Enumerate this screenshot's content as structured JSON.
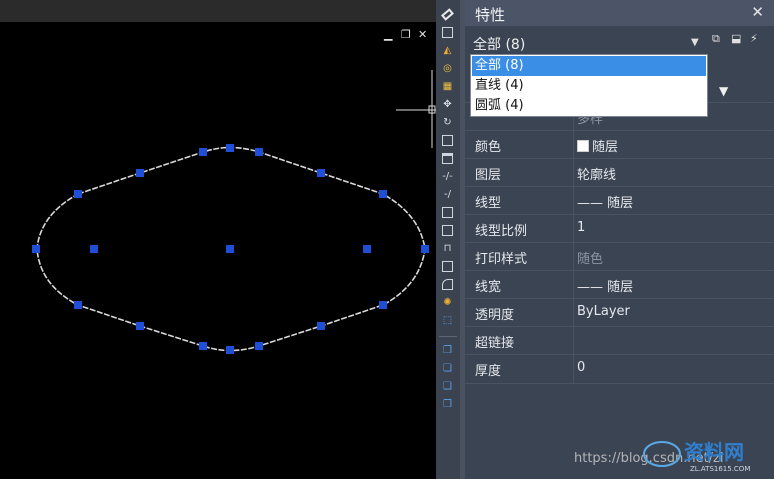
{
  "canvas": {
    "window_controls": {
      "minimize": "▁",
      "restore": "❐",
      "close": "✕"
    }
  },
  "toolbar": {
    "icons": [
      "eraser-icon",
      "copy-icon",
      "mirror-icon",
      "offset-icon",
      "array-icon",
      "move-icon",
      "rotate-icon",
      "scale-icon",
      "stretch-icon",
      "trim-icon",
      "extend-icon",
      "break-icon",
      "break-at-point-icon",
      "join-icon",
      "chamfer-icon",
      "fillet-icon",
      "blend-icon",
      "explode-icon",
      "edit-icon",
      "draw-order-icon",
      "bring-front-icon",
      "send-back-icon",
      "text-front-icon"
    ]
  },
  "panel": {
    "title": "特性",
    "close_label": "✕",
    "selector": {
      "value": "全部 (8)"
    },
    "dropdown": {
      "options": [
        "全部 (8)",
        "直线 (4)",
        "圆弧 (4)"
      ],
      "selected_index": 0
    },
    "properties": [
      {
        "name": "",
        "value": "多样",
        "muted": true,
        "partial": true
      },
      {
        "name": "颜色",
        "value": "随层",
        "swatch": "#ffffff"
      },
      {
        "name": "图层",
        "value": "轮廓线"
      },
      {
        "name": "线型",
        "value": "—— 随层"
      },
      {
        "name": "线型比例",
        "value": "1"
      },
      {
        "name": "打印样式",
        "value": "随色",
        "muted": true
      },
      {
        "name": "线宽",
        "value": "—— 随层"
      },
      {
        "name": "透明度",
        "value": "ByLayer"
      },
      {
        "name": "超链接",
        "value": ""
      },
      {
        "name": "厚度",
        "value": "0"
      }
    ]
  },
  "watermark": {
    "text": "https://blog.csdn.net/zl",
    "logo_text": "资料网",
    "logo_sub": "ZL.ATS1615.COM"
  },
  "colors": {
    "panel_bg": "#3b4453",
    "grip": "#1e4fd6",
    "selection": "#3a8ee6"
  }
}
